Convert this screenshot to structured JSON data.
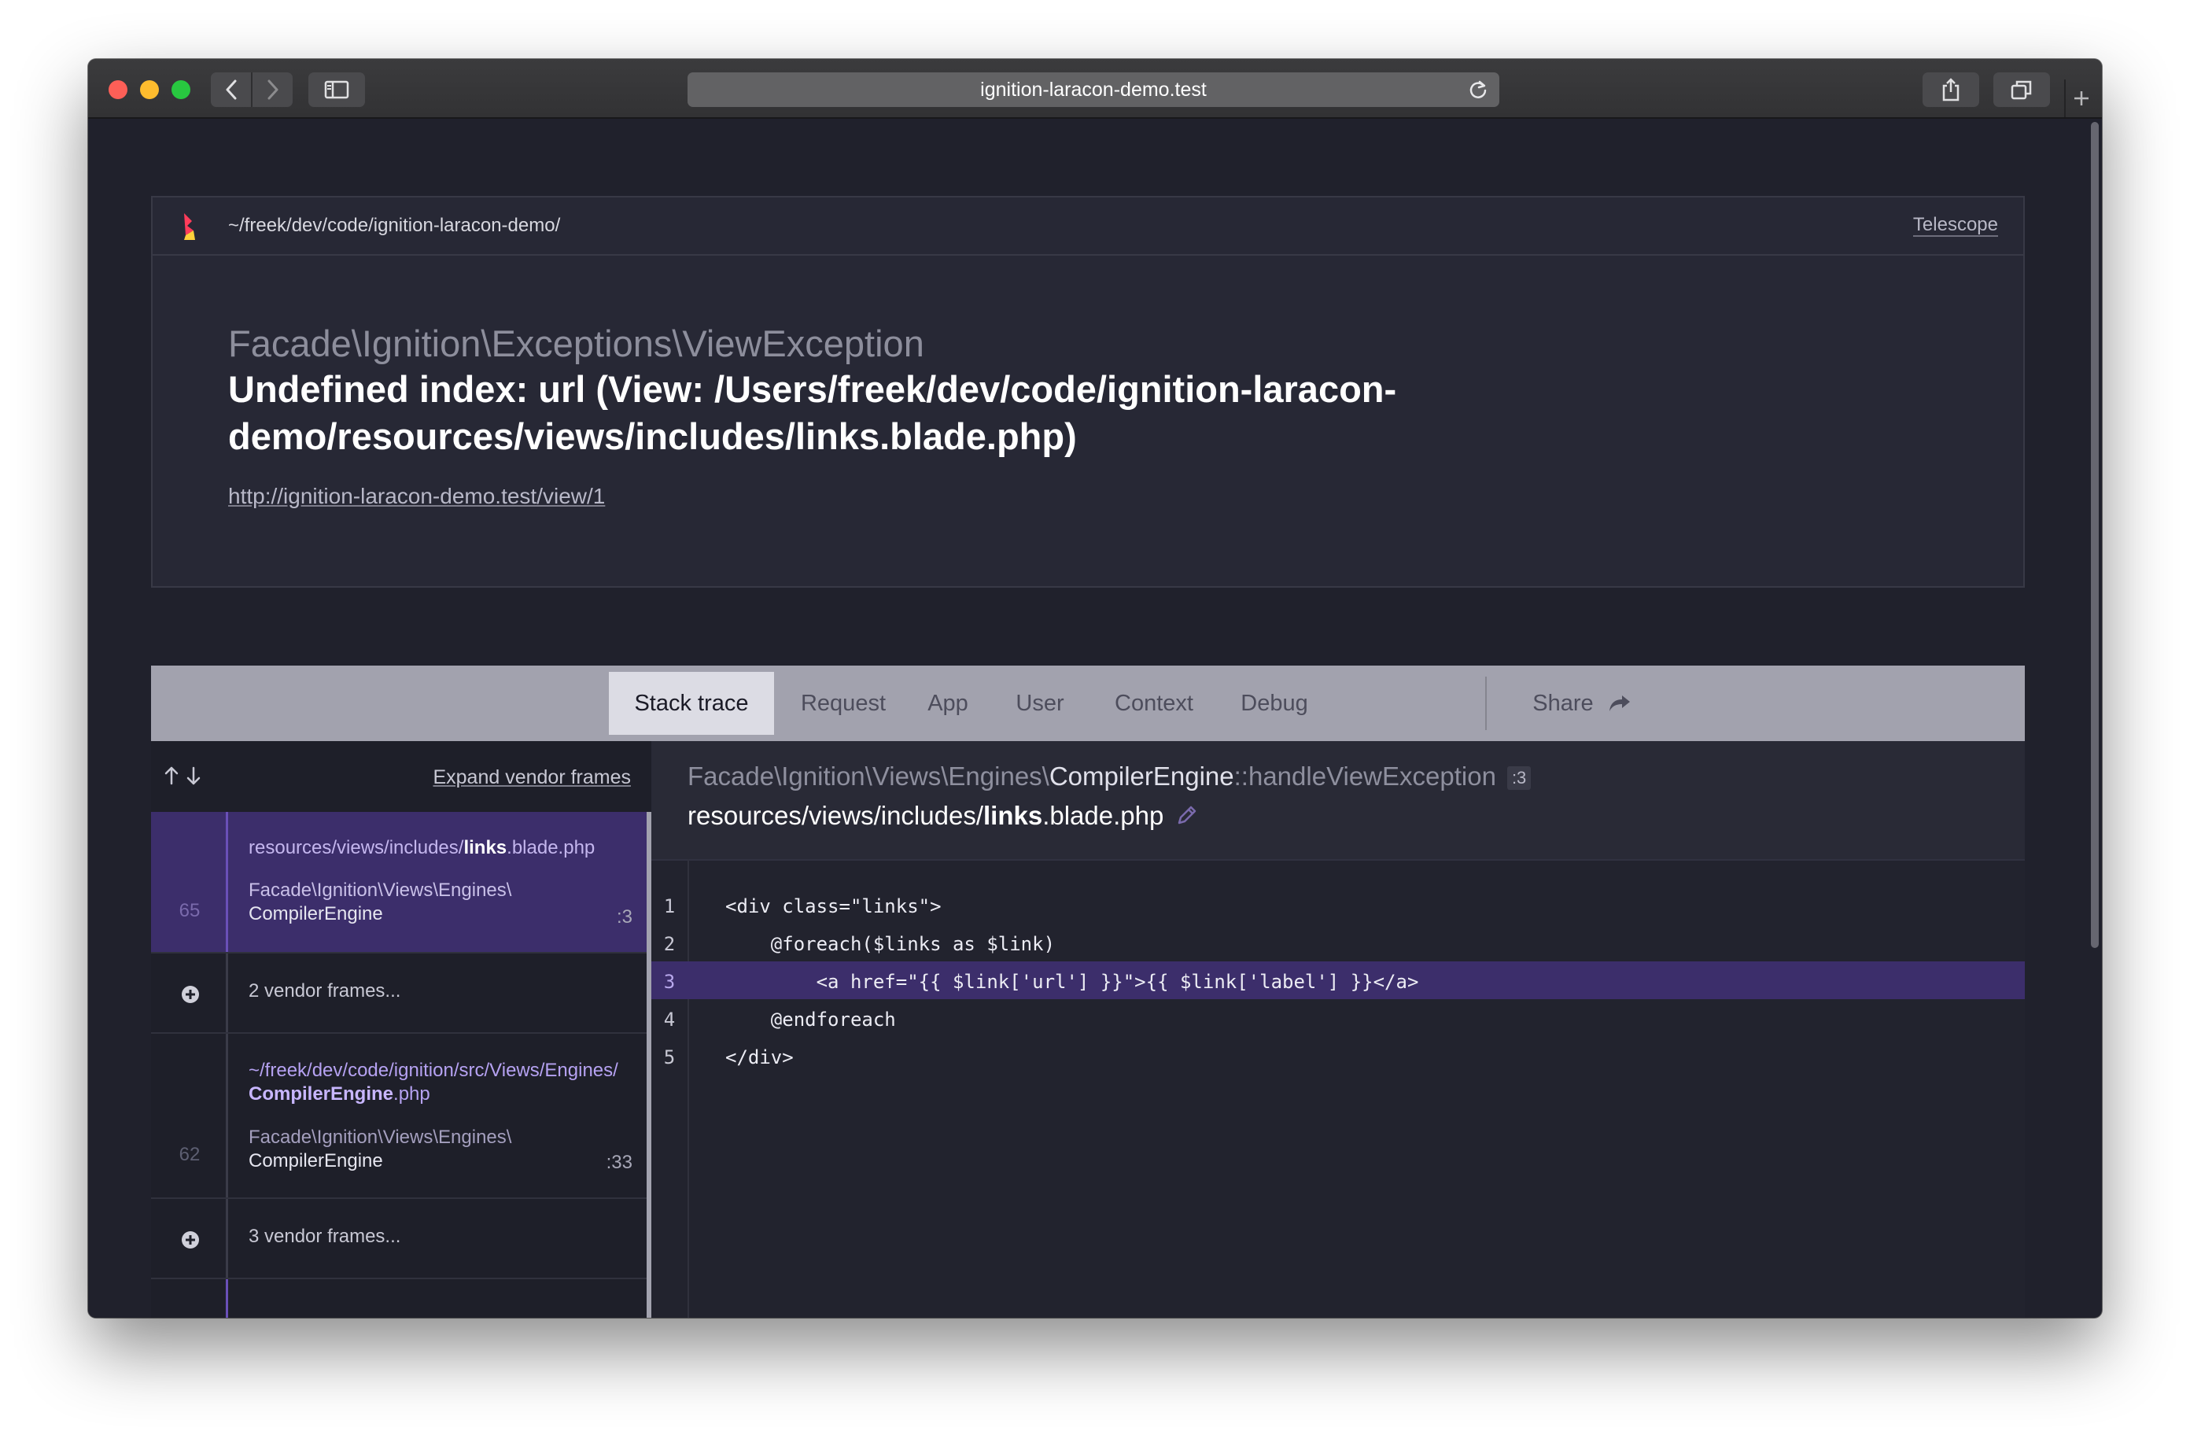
{
  "browser": {
    "url": "ignition-laracon-demo.test"
  },
  "header": {
    "project_path": "~/freek/dev/code/ignition-laracon-demo/",
    "telescope_link": "Telescope",
    "exception_class": "Facade\\Ignition\\Exceptions\\ViewException",
    "exception_message": "Undefined index: url (View: /Users/freek/dev/code/ignition-laracon-demo/resources/views/includes/links.blade.php)",
    "request_url": "http://ignition-laracon-demo.test/view/1"
  },
  "tabs": [
    {
      "label": "Stack trace",
      "active": true
    },
    {
      "label": "Request"
    },
    {
      "label": "App"
    },
    {
      "label": "User"
    },
    {
      "label": "Context"
    },
    {
      "label": "Debug"
    },
    {
      "label": "Share"
    }
  ],
  "frames": {
    "expand_label": "Expand vendor frames",
    "items": [
      {
        "line_number": "65",
        "file_prefix": "resources/views/includes/",
        "file_name": "links",
        "file_suffix": ".blade.php",
        "namespace": "Facade\\Ignition\\Views\\Engines\\",
        "class": "CompilerEngine",
        "line": ":3"
      },
      {
        "vendor_label": "2 vendor frames..."
      },
      {
        "line_number": "62",
        "file_prefix": "~/freek/dev/code/ignition/src/Views/Engines/",
        "file_name": "CompilerEngine",
        "file_suffix": ".php",
        "namespace": "Facade\\Ignition\\Views\\Engines\\",
        "class": "CompilerEngine",
        "line": ":33"
      },
      {
        "vendor_label": "3 vendor frames..."
      }
    ]
  },
  "code_view": {
    "class_prefix": "Facade\\Ignition\\Views\\Engines\\",
    "class_name": "CompilerEngine",
    "method": "::handleViewException",
    "line_badge": ":3",
    "file_prefix": "resources/views/includes/",
    "file_name": "links",
    "file_suffix": ".blade.php",
    "lines": [
      {
        "num": "1",
        "code": "<div class=\"links\">"
      },
      {
        "num": "2",
        "code": "    @foreach($links as $link)"
      },
      {
        "num": "3",
        "code": "        <a href=\"{{ $link['url'] }}\">{{ $link['label'] }}</a>",
        "highlighted": true
      },
      {
        "num": "4",
        "code": "    @endforeach"
      },
      {
        "num": "5",
        "code": "</div>"
      }
    ]
  },
  "colors": {
    "background": "#20212c",
    "accent_purple": "#3c2e6b",
    "tabbar": "#a2a2ae"
  }
}
